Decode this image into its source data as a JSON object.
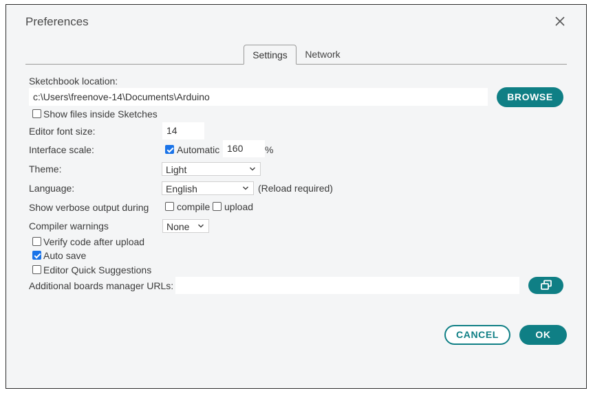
{
  "dialog": {
    "title": "Preferences"
  },
  "tabs": [
    {
      "label": "Settings",
      "active": true
    },
    {
      "label": "Network",
      "active": false
    }
  ],
  "settings": {
    "sketchbook_label": "Sketchbook location:",
    "sketchbook_value": "c:\\Users\\freenove-14\\Documents\\Arduino",
    "browse_label": "BROWSE",
    "show_files_label": "Show files inside Sketches",
    "show_files_checked": false,
    "font_size_label": "Editor font size:",
    "font_size_value": "14",
    "interface_scale_label": "Interface scale:",
    "automatic_label": "Automatic",
    "automatic_checked": true,
    "scale_value": "160",
    "scale_unit": "%",
    "theme_label": "Theme:",
    "theme_value": "Light",
    "language_label": "Language:",
    "language_value": "English",
    "language_note": "(Reload required)",
    "verbose_label": "Show verbose output during",
    "compile_label": "compile",
    "compile_checked": false,
    "upload_label": "upload",
    "upload_checked": false,
    "warnings_label": "Compiler warnings",
    "warnings_value": "None",
    "verify_label": "Verify code after upload",
    "verify_checked": false,
    "autosave_label": "Auto save",
    "autosave_checked": true,
    "quick_suggestions_label": "Editor Quick Suggestions",
    "quick_suggestions_checked": false,
    "boards_urls_label": "Additional boards manager URLs:",
    "boards_urls_value": ""
  },
  "footer": {
    "cancel_label": "CANCEL",
    "ok_label": "OK"
  },
  "colors": {
    "accent": "#0f7f85",
    "checkbox": "#1a73e8",
    "dialog_bg": "#f4f5f6"
  },
  "icons": {
    "close": "close-icon",
    "open_window": "open-window-icon",
    "chevron": "chevron-down-icon"
  }
}
